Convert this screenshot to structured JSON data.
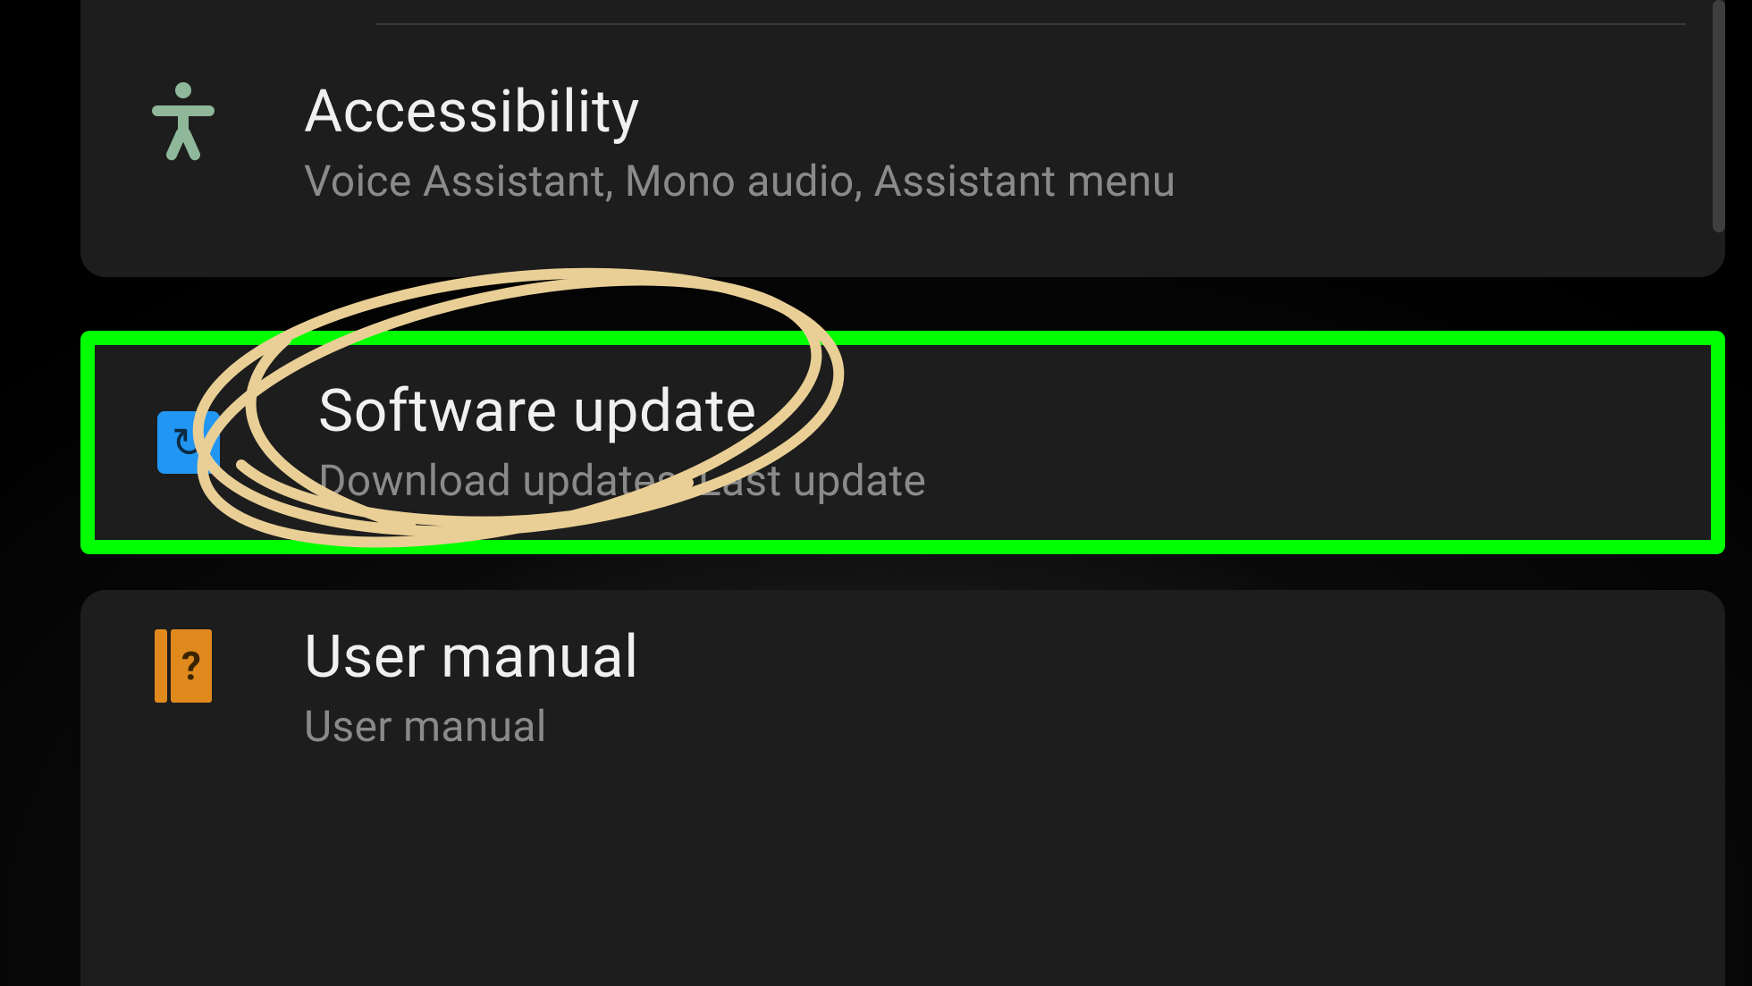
{
  "settings": {
    "items": [
      {
        "key": "accessibility",
        "title": "Accessibility",
        "subtitle": "Voice Assistant, Mono audio, Assistant menu",
        "icon": "person-icon",
        "highlighted": false
      },
      {
        "key": "software_update",
        "title": "Software update",
        "subtitle": "Download updates, Last update",
        "icon": "update-icon",
        "highlighted": true,
        "highlight_color": "#00ff00",
        "circle_annotation_color": "#e9cf96"
      },
      {
        "key": "user_manual",
        "title": "User manual",
        "subtitle": "User manual",
        "icon": "manual-icon",
        "highlighted": false
      }
    ]
  }
}
